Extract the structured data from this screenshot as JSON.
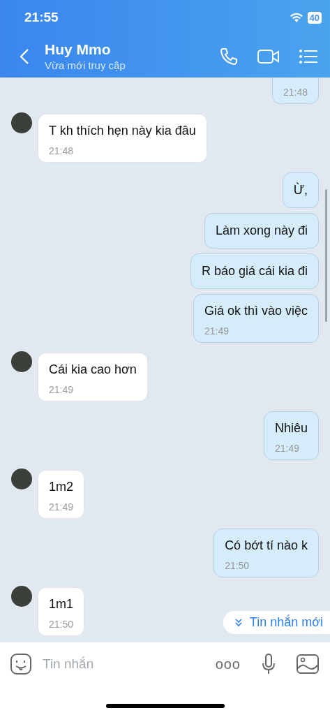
{
  "status_bar": {
    "time": "21:55",
    "battery": "40"
  },
  "header": {
    "title": "Huy Mmo",
    "subtitle": "Vừa mới truy cập"
  },
  "messages": [
    {
      "kind": "sent",
      "time": "21:48"
    },
    {
      "kind": "received",
      "text": "T kh thích hẹn này kia đâu",
      "time": "21:48"
    },
    {
      "kind": "sent",
      "text": "Ừ,"
    },
    {
      "kind": "sent",
      "text": "Làm xong này đi"
    },
    {
      "kind": "sent",
      "text": "R báo giá cái kia đi"
    },
    {
      "kind": "sent",
      "text": "Giá ok thì vào việc",
      "time": "21:49"
    },
    {
      "kind": "received",
      "text": "Cái kia cao hơn",
      "time": "21:49"
    },
    {
      "kind": "sent",
      "text": "Nhiêu",
      "time": "21:49"
    },
    {
      "kind": "received",
      "text": "1m2",
      "time": "21:49"
    },
    {
      "kind": "sent",
      "text": "Có bớt tí nào k",
      "time": "21:50"
    },
    {
      "kind": "received",
      "text": "1m1",
      "time": "21:50"
    }
  ],
  "new_messages_button": {
    "label": "Tin nhắn mới"
  },
  "composer": {
    "placeholder": "Tin nhắn",
    "more": "ooo"
  }
}
